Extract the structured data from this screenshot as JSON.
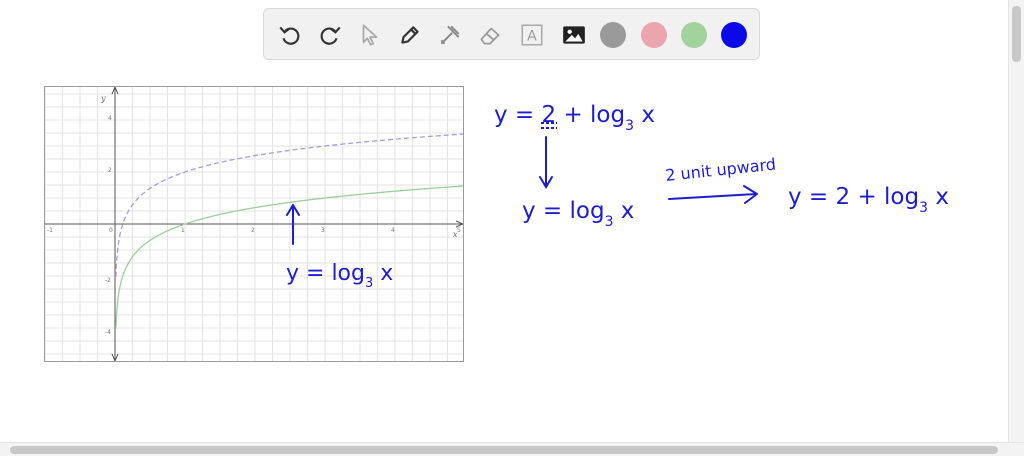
{
  "toolbar": {
    "tools": [
      "undo-icon",
      "redo-icon",
      "select-pointer-icon",
      "pen-icon",
      "tools-icon",
      "eraser-icon",
      "text-tool-icon",
      "image-icon"
    ],
    "text_tool_glyph": "A",
    "colors": [
      "#9a9a9a",
      "#eba5ae",
      "#a3d39c",
      "#0a0ae8"
    ]
  },
  "graph": {
    "x_axis_label": "x",
    "y_axis_label": "y",
    "x_ticks": [
      "-1",
      "0",
      "1",
      "2",
      "3",
      "4",
      "5"
    ],
    "y_ticks": [
      "4",
      "2",
      "-2",
      "-4"
    ],
    "curves": [
      {
        "equation": "y = log_3 x",
        "style": "solid",
        "color": "#9bcf9b"
      },
      {
        "equation": "y = 2 + log_3 x",
        "style": "dashed",
        "color": "#a99be0"
      }
    ]
  },
  "notes": {
    "eq_top": {
      "prefix": "y = 2 + log",
      "sub": "3",
      "suffix": " x"
    },
    "eq_parent": {
      "prefix": "y = log",
      "sub": "3",
      "suffix": " x"
    },
    "arrow_label": "2 unit upward",
    "eq_result": {
      "prefix": "y = 2 + log",
      "sub": "3",
      "suffix": " x"
    },
    "graph_label": {
      "prefix": "y = log",
      "sub": "3",
      "suffix": " x"
    }
  },
  "ink_color": "#1d1dd0"
}
